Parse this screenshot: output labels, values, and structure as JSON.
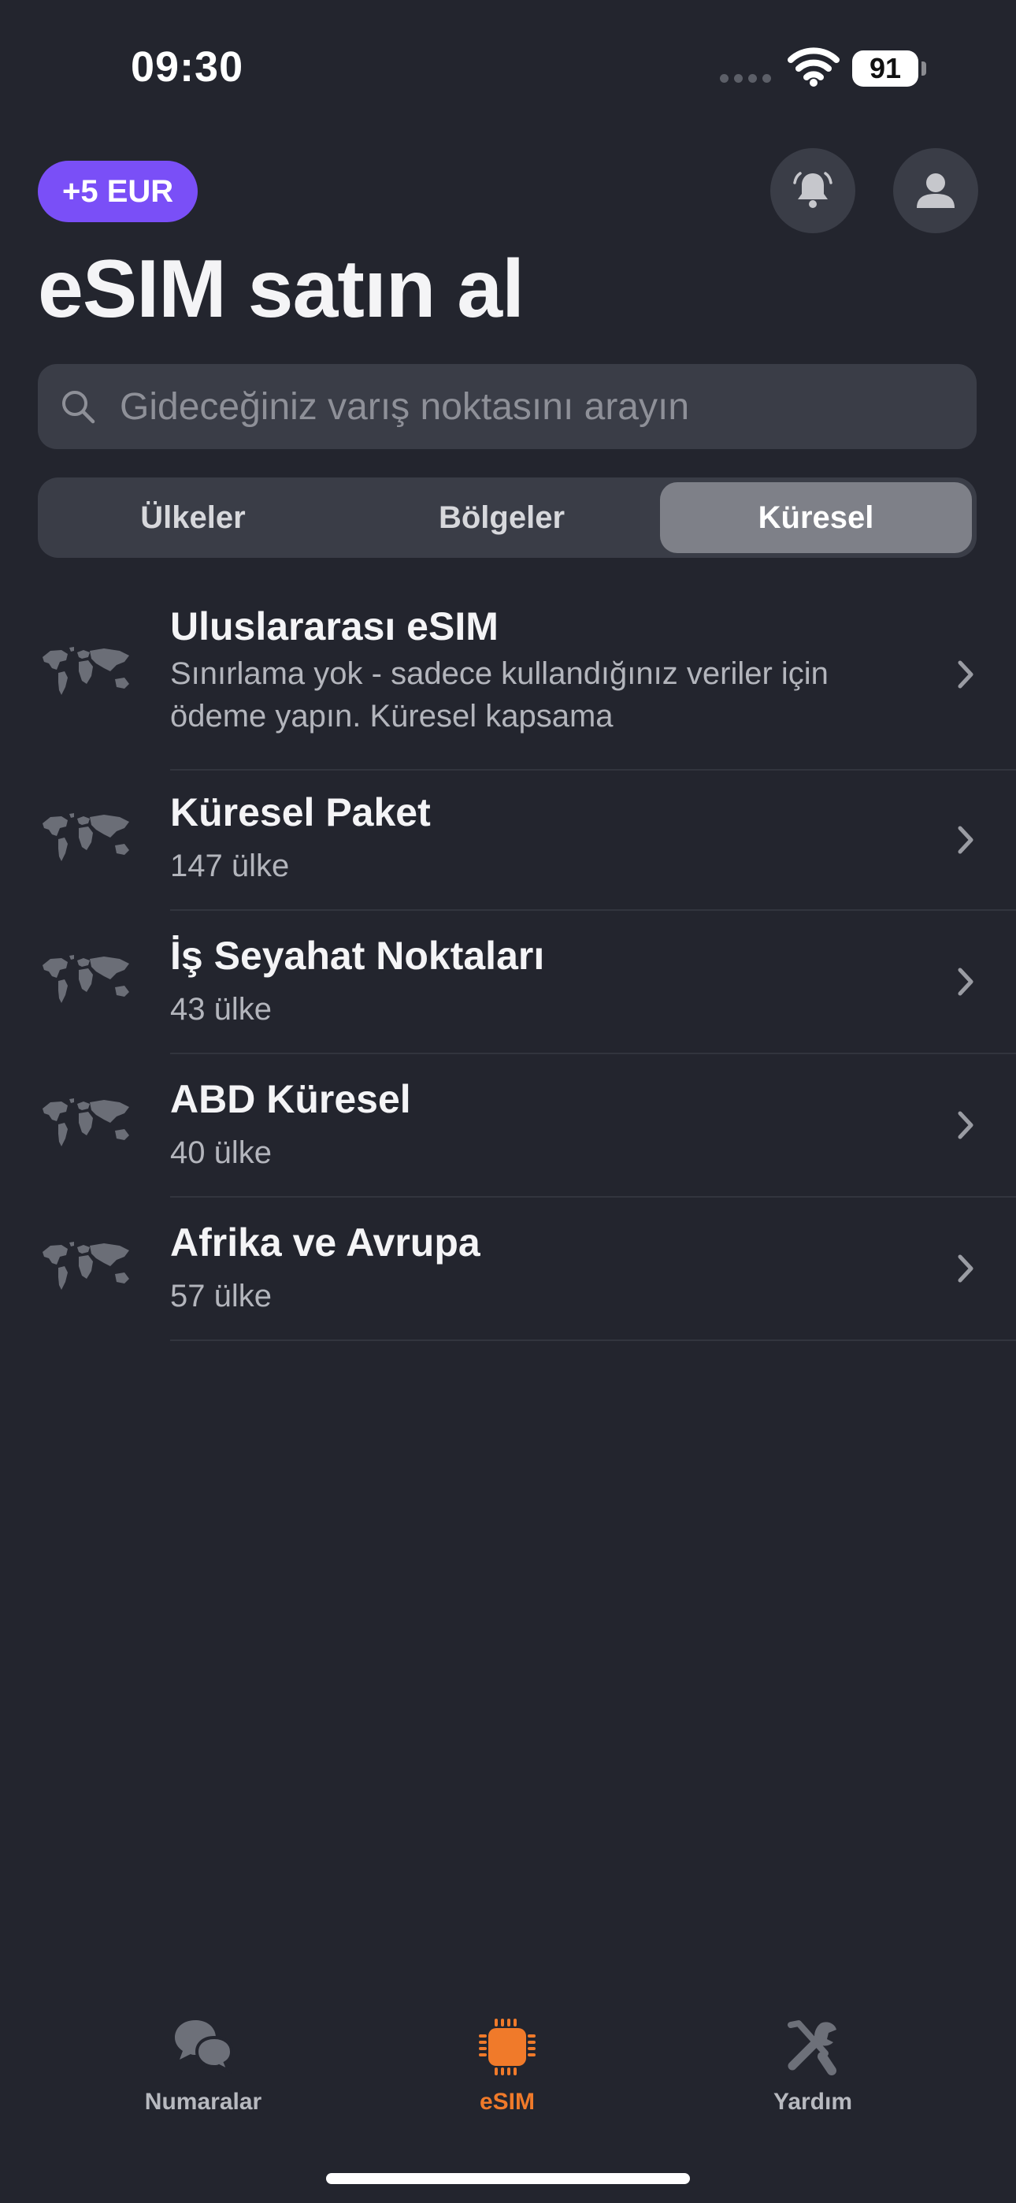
{
  "status": {
    "time": "09:30",
    "battery": "91"
  },
  "header": {
    "credit_badge": "+5 EUR",
    "title": "eSIM satın al"
  },
  "search": {
    "placeholder": "Gideceğiniz varış noktasını arayın"
  },
  "segments": [
    {
      "label": "Ülkeler",
      "selected": false
    },
    {
      "label": "Bölgeler",
      "selected": false
    },
    {
      "label": "Küresel",
      "selected": true
    }
  ],
  "plans": [
    {
      "title": "Uluslararası eSIM",
      "subtitle": "Sınırlama yok - sadece kullandığınız veriler için ödeme yapın. Küresel kapsama",
      "icon": "world-map-icon"
    },
    {
      "title": "Küresel Paket",
      "subtitle": "147 ülke",
      "icon": "world-map-icon"
    },
    {
      "title": "İş Seyahat Noktaları",
      "subtitle": "43 ülke",
      "icon": "world-map-icon"
    },
    {
      "title": "ABD Küresel",
      "subtitle": "40 ülke",
      "icon": "world-map-icon"
    },
    {
      "title": "Afrika ve Avrupa",
      "subtitle": "57 ülke",
      "icon": "world-map-icon"
    }
  ],
  "tabbar": [
    {
      "label": "Numaralar",
      "icon": "chat-bubbles-icon",
      "active": false
    },
    {
      "label": "eSIM",
      "icon": "chip-icon",
      "active": true
    },
    {
      "label": "Yardım",
      "icon": "tools-icon",
      "active": false
    }
  ],
  "colors": {
    "background": "#23252e",
    "accent": "#f07a2a",
    "badge": "#7a4ff7",
    "surface": "#3a3d47"
  }
}
